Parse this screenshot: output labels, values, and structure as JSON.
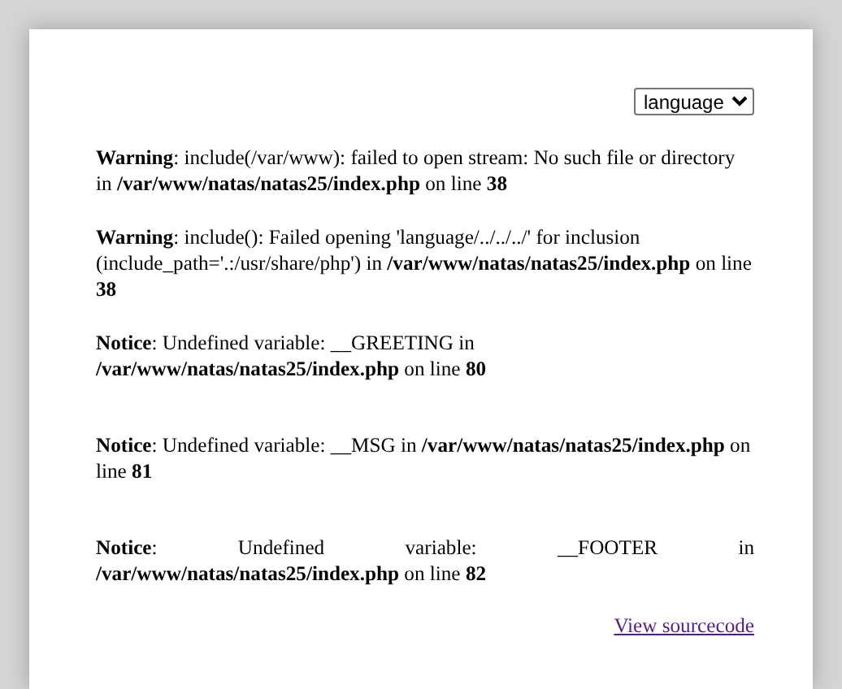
{
  "language_select": {
    "value": "language"
  },
  "messages": [
    {
      "text": "**Warning**: include(/var/www): failed to open stream: No such file or directory in **/var/www/natas/natas25/index.php** on line **38**",
      "justified": false
    },
    {
      "text": "**Warning**: include(): Failed opening 'language/../../../' for inclusion (include_path='.:/usr/share/php') in **/var/www/natas/natas25/index.php** on line **38**",
      "justified": false
    },
    {
      "text": "**Notice**: Undefined variable: __GREETING in **/var/www/natas/natas25/index.php** on line **80**",
      "justified": false
    },
    {
      "text": "**Notice**: Undefined variable: __MSG in **/var/www/natas/natas25/index.php** on line **81**",
      "justified": false
    },
    {
      "text": "**Notice**: Undefined variable: __FOOTER in **/var/www/natas/natas25/index.php** on line **82**",
      "justified": true
    }
  ],
  "source_link": "View sourcecode"
}
